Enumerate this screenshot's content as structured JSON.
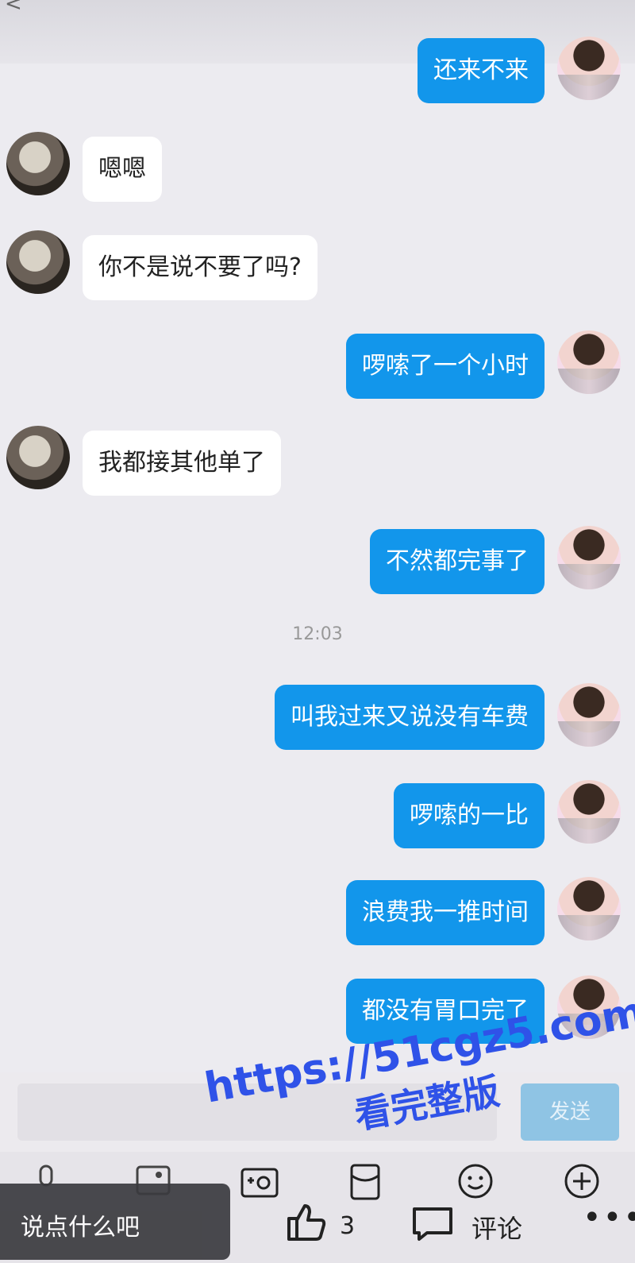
{
  "messages": [
    {
      "side": "out",
      "text": "还来不来"
    },
    {
      "side": "in",
      "text": "嗯嗯"
    },
    {
      "side": "in",
      "text": "你不是说不要了吗?"
    },
    {
      "side": "out",
      "text": "啰嗦了一个小时"
    },
    {
      "side": "in",
      "text": "我都接其他单了"
    },
    {
      "side": "out",
      "text": "不然都完事了"
    },
    {
      "side": "out",
      "text": "叫我过来又说没有车费"
    },
    {
      "side": "out",
      "text": "啰嗦的一比"
    },
    {
      "side": "out",
      "text": "浪费我一推时间"
    },
    {
      "side": "out",
      "text": "都没有胃口完了"
    }
  ],
  "timestamp": "12:03",
  "input": {
    "send_label": "发送"
  },
  "bottom": {
    "comment_placeholder": "说点什么吧",
    "like_count": "3",
    "comment_label": "评论"
  },
  "watermark": {
    "url": "https://51cgz5.com",
    "text": "看完整版"
  },
  "colors": {
    "outgoing_bubble": "#1296eb",
    "incoming_bubble": "#ffffff",
    "background": "#ecebf0"
  }
}
